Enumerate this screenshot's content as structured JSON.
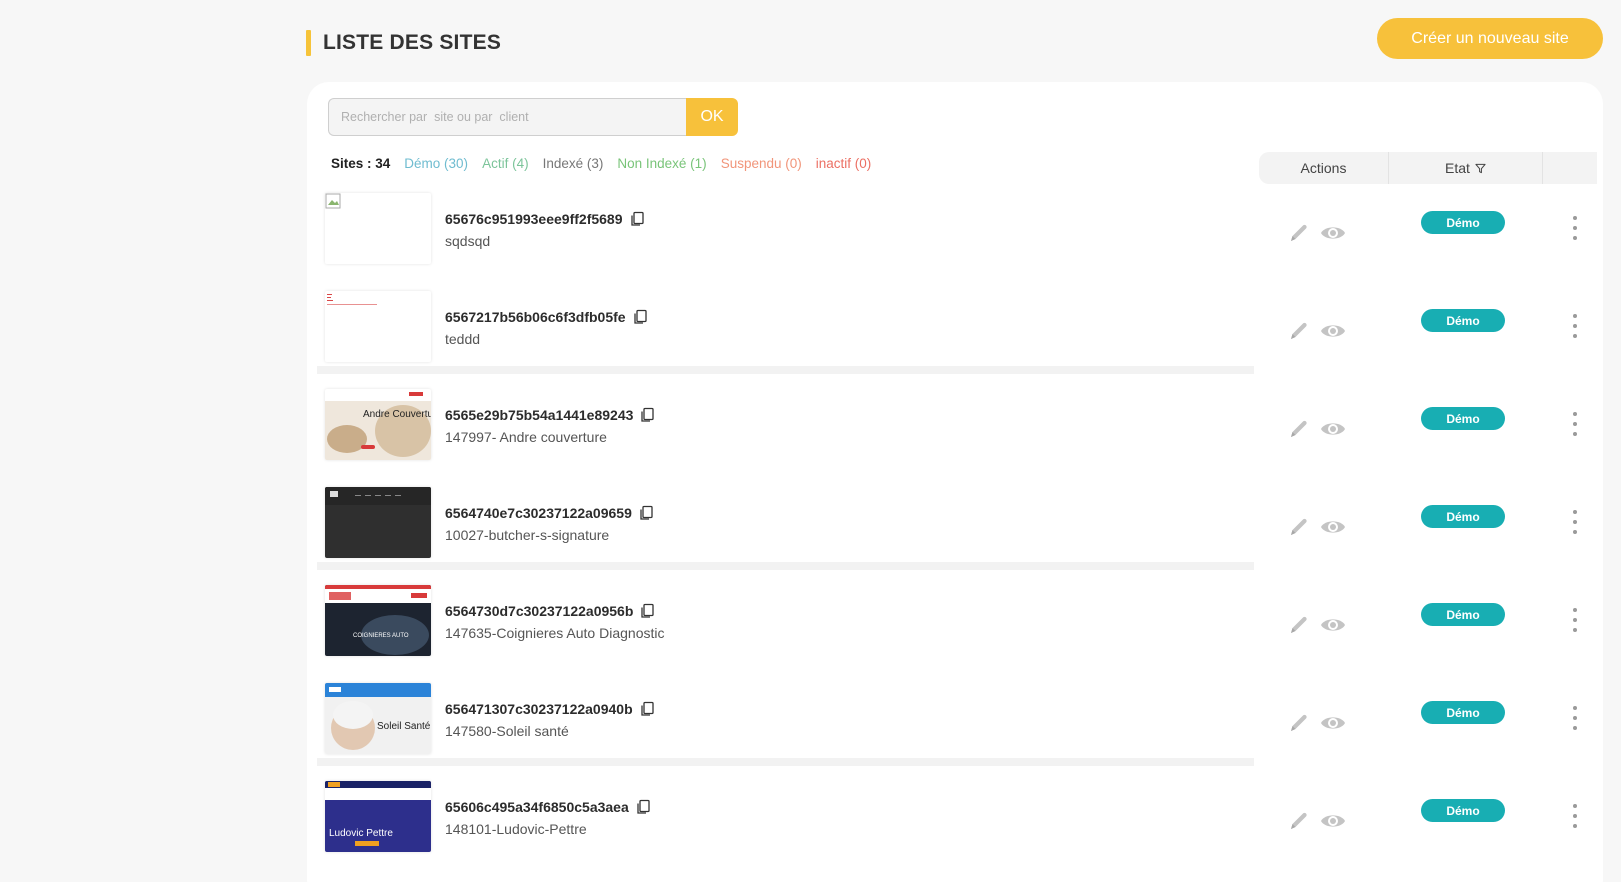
{
  "header": {
    "title": "LISTE DES SITES",
    "create_button": "Créer un nouveau site"
  },
  "search": {
    "placeholder": "Rechercher par  site ou par  client",
    "ok_label": "OK"
  },
  "filters": {
    "total": "Sites : 34",
    "demo": "Démo (30)",
    "actif": "Actif (4)",
    "indexe": "Indexé (3)",
    "non_indexe": "Non Indexé (1)",
    "suspendu": "Suspendu (0)",
    "inactif": "inactif (0)"
  },
  "table": {
    "col_actions": "Actions",
    "col_etat": "Etat"
  },
  "sites": [
    {
      "id": "65676c951993eee9ff2f5689",
      "name": "sqdsqd",
      "status": "Démo"
    },
    {
      "id": "6567217b56b06c6f3dfb05fe",
      "name": "teddd",
      "status": "Démo"
    },
    {
      "id": "6565e29b75b54a1441e89243",
      "name": "147997- Andre couverture",
      "status": "Démo",
      "thumb_text": "Andre Couverture"
    },
    {
      "id": "6564740e7c30237122a09659",
      "name": "10027-butcher-s-signature",
      "status": "Démo"
    },
    {
      "id": "6564730d7c30237122a0956b",
      "name": "147635-Coignieres Auto Diagnostic",
      "status": "Démo",
      "thumb_text": "COIGNIERES AUTO"
    },
    {
      "id": "656471307c30237122a0940b",
      "name": "147580-Soleil santé",
      "status": "Démo",
      "thumb_text": "Soleil Santé"
    },
    {
      "id": "65606c495a34f6850c5a3aea",
      "name": "148101-Ludovic-Pettre",
      "status": "Démo",
      "thumb_text": "Ludovic Pettre"
    }
  ],
  "colors": {
    "accent": "#f7c13b",
    "status_demo": "#18aeb3"
  }
}
